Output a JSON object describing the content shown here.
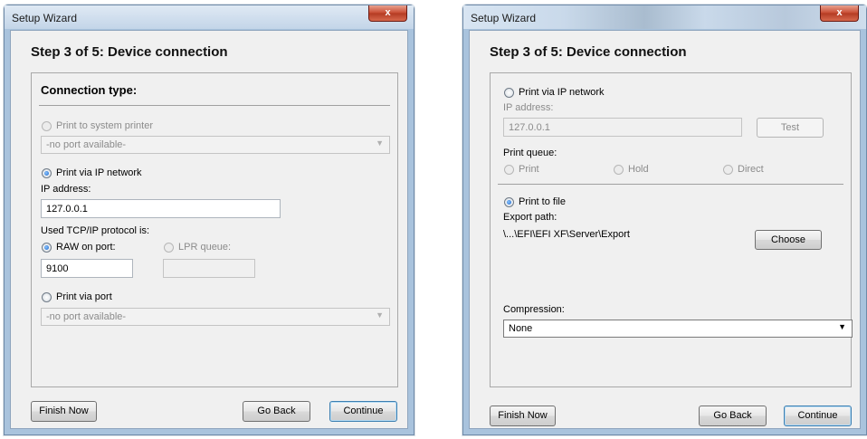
{
  "left_window": {
    "title": "Setup Wizard",
    "close_label": "x",
    "step_title": "Step 3 of 5: Device connection",
    "section_title": "Connection type:",
    "system_printer": {
      "label": "Print to system printer",
      "selected": false,
      "enabled": false,
      "port_select": "-no port available-"
    },
    "ip_network": {
      "label": "Print via IP network",
      "selected": true,
      "ip_label": "IP address:",
      "ip_value": "127.0.0.1",
      "protocol_label": "Used TCP/IP protocol is:",
      "raw_label": "RAW on port:",
      "raw_selected": true,
      "port_value": "9100",
      "lpr_label": "LPR queue:",
      "lpr_value": ""
    },
    "via_port": {
      "label": "Print via port",
      "selected": false,
      "port_select": "-no port available-"
    },
    "buttons": {
      "finish_now": "Finish Now",
      "go_back": "Go Back",
      "continue": "Continue"
    }
  },
  "right_window": {
    "title": "Setup Wizard",
    "close_label": "x",
    "step_title": "Step 3 of 5: Device connection",
    "ip_network": {
      "label": "Print via IP network",
      "selected": false,
      "ip_label": "IP address:",
      "ip_value": "127.0.0.1",
      "test_button": "Test"
    },
    "print_queue": {
      "label": "Print queue:",
      "options": [
        "Print",
        "Hold",
        "Direct"
      ]
    },
    "print_to_file": {
      "label": "Print to file",
      "selected": true,
      "export_label": "Export path:",
      "export_path": "\\...\\EFI\\EFI XF\\Server\\Export",
      "choose_button": "Choose"
    },
    "compression": {
      "label": "Compression:",
      "value": "None"
    },
    "buttons": {
      "finish_now": "Finish Now",
      "go_back": "Go Back",
      "continue": "Continue"
    }
  },
  "colors": {
    "window_frame": "#a9c3dd",
    "client_bg": "#f0f0f0",
    "close_button": "#c74a30",
    "radio_dot": "#1660c7",
    "disabled_text": "#8b8b8b"
  }
}
